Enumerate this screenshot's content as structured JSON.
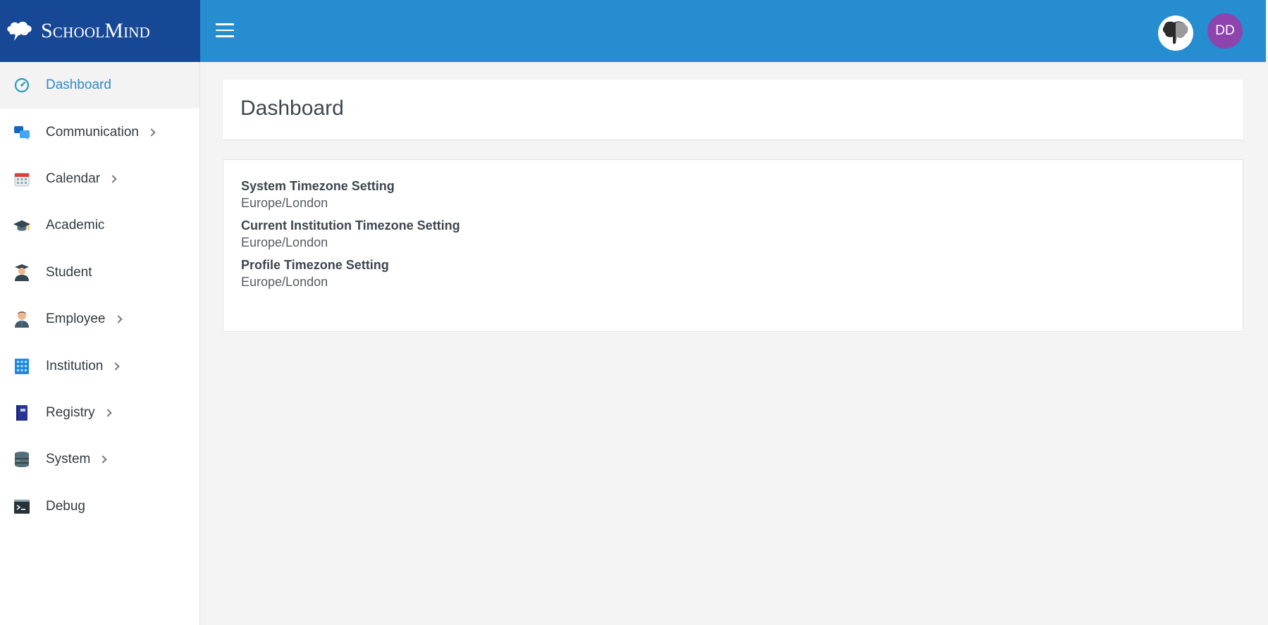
{
  "brand": {
    "name": "SchoolMind"
  },
  "header": {
    "user_initials": "DD",
    "icons": {
      "menu": "hamburger-menu-icon",
      "language": "flag-icon"
    },
    "colors": {
      "topbar": "#258dd0",
      "brand": "#174896",
      "avatar": "#8e44ad"
    }
  },
  "sidebar": {
    "items": [
      {
        "label": "Dashboard",
        "icon": "dashboard-gauge-icon",
        "has_children": false,
        "active": true
      },
      {
        "label": "Communication",
        "icon": "chat-bubbles-icon",
        "has_children": true
      },
      {
        "label": "Calendar",
        "icon": "calendar-icon",
        "has_children": true
      },
      {
        "label": "Academic",
        "icon": "graduation-cap-icon",
        "has_children": false
      },
      {
        "label": "Student",
        "icon": "student-icon",
        "has_children": false
      },
      {
        "label": "Employee",
        "icon": "employee-icon",
        "has_children": true
      },
      {
        "label": "Institution",
        "icon": "building-icon",
        "has_children": true
      },
      {
        "label": "Registry",
        "icon": "book-icon",
        "has_children": true
      },
      {
        "label": "System",
        "icon": "server-icon",
        "has_children": true
      },
      {
        "label": "Debug",
        "icon": "terminal-icon",
        "has_children": false
      }
    ]
  },
  "main": {
    "title": "Dashboard",
    "settings": [
      {
        "label": "System Timezone Setting",
        "value": "Europe/London"
      },
      {
        "label": "Current Institution Timezone Setting",
        "value": "Europe/London"
      },
      {
        "label": "Profile Timezone Setting",
        "value": "Europe/London"
      }
    ]
  }
}
